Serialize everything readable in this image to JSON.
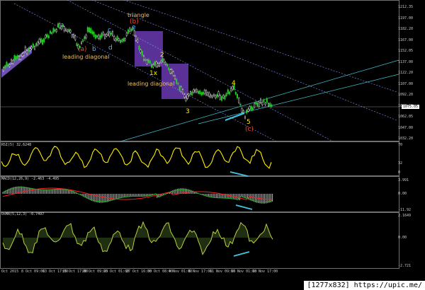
{
  "chart_data": [
    {
      "type": "line",
      "ylim": [
        1025,
        1215
      ],
      "yticks": [
        "1212.35",
        "1197.00",
        "1182.20",
        "1167.00",
        "1152.05",
        "1137.00",
        "1122.20",
        "1107.00",
        "1092.20",
        "1077.00",
        "1062.05",
        "1047.00",
        "1032.20"
      ],
      "current_price": "1075.05",
      "grid": false,
      "wave_labels": [
        {
          "text": "a",
          "color": "#4fb4ff"
        },
        {
          "text": "b",
          "color": "#4fb4ff"
        },
        {
          "text": "c",
          "color": "#4fb4ff"
        },
        {
          "text": "d",
          "color": "#4fb4ff"
        },
        {
          "text": "e",
          "color": "#4fb4ff"
        },
        {
          "text": "(a)",
          "color": "#ff4422"
        },
        {
          "text": "(b)",
          "color": "#ff4422"
        },
        {
          "text": "(c)",
          "color": "#ff4422"
        },
        {
          "text": "1x",
          "color": "#ffee00"
        },
        {
          "text": "2",
          "color": "#ffee00"
        },
        {
          "text": "3",
          "color": "#ffee00"
        },
        {
          "text": "4",
          "color": "#ffee00"
        },
        {
          "text": "5",
          "color": "#ffee00"
        }
      ],
      "annotations": [
        "triangle",
        "leading diagonal",
        "leading diagonal"
      ]
    },
    {
      "type": "line",
      "label": "RSI(5) 32.6248",
      "yticks": [
        "70",
        "32",
        "0"
      ],
      "series_color": "#ffee00"
    },
    {
      "type": "bar",
      "label": "MACD(12,26,9) -2.463 -4.495",
      "yticks": [
        "3.991",
        "0.00",
        "-11.92"
      ],
      "signal_color": "#ff2222",
      "line_color": "#22aa22"
    },
    {
      "type": "line",
      "label": "OsMA(5,12,3) -0.7497",
      "yticks": [
        "2.1649",
        "0.00",
        "-2.721"
      ],
      "series_color": "#b8d040"
    }
  ],
  "time_axis": [
    "Oct 2015",
    "8 Oct 09:00",
    "13 Oct 17:00",
    "15 Oct 17:00",
    "20 Oct 09:00",
    "23 Oct 01:00",
    "27 Oct 16:00",
    "30 Oct 08:00",
    "4 Nov 01:00",
    "6 Nov 17:00",
    "11 Nov 09:00",
    "16 Nov 01:00",
    "18 Nov 17:00"
  ],
  "stamp": "[1277x832] https://upic.me/",
  "colors": {
    "candle_up": "#22cc22",
    "candle_down": "#ffffff",
    "purple_box": "#6a3ab0",
    "channel": "#8899ff",
    "trend": "#40c0d0",
    "arrow": "#40c8e0"
  }
}
